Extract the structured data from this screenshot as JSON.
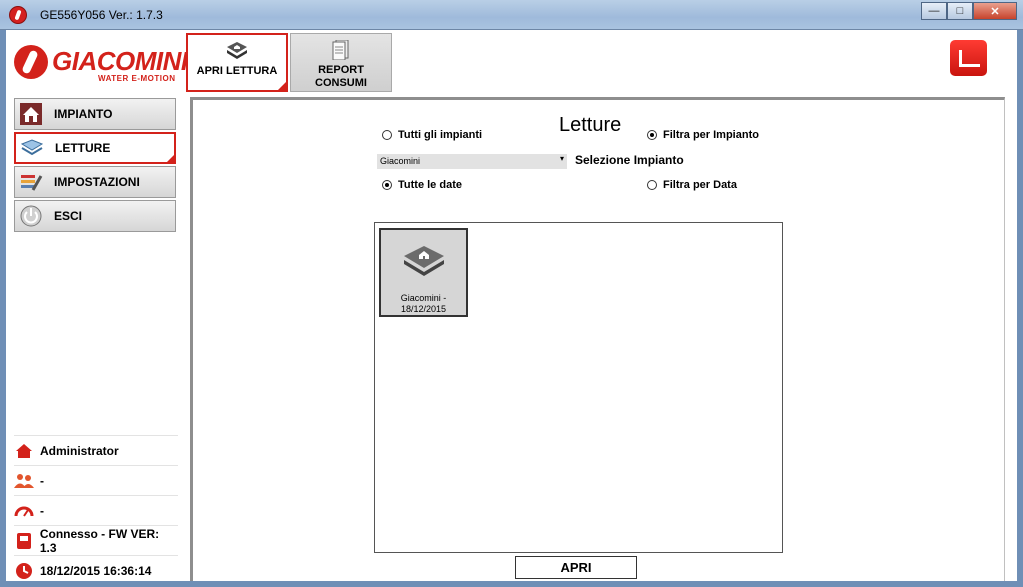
{
  "window": {
    "title": "GE556Y056 Ver.: 1.7.3",
    "minimize_glyph": "—",
    "maximize_glyph": "□",
    "close_glyph": "✕"
  },
  "logo": {
    "name": "GIACOMINI",
    "tagline": "WATER E-MOTION"
  },
  "tabs": [
    {
      "label": "APRI LETTURA",
      "icon": "folder-home-icon",
      "active": true
    },
    {
      "label": "REPORT\nCONSUMI",
      "icon": "document-icon",
      "active": false
    }
  ],
  "sidebar": {
    "items": [
      {
        "label": "IMPIANTO",
        "icon": "house-icon"
      },
      {
        "label": "LETTURE",
        "icon": "readings-icon",
        "active": true
      },
      {
        "label": "IMPOSTAZIONI",
        "icon": "tools-icon"
      },
      {
        "label": "ESCI",
        "icon": "power-icon"
      }
    ],
    "status": [
      {
        "label": "Administrator",
        "icon": "user-home-icon"
      },
      {
        "label": "-",
        "icon": "users-icon"
      },
      {
        "label": "-",
        "icon": "gauge-icon"
      },
      {
        "label": "Connesso - FW VER: 1.3",
        "icon": "device-icon"
      },
      {
        "label": "18/12/2015 16:36:14",
        "icon": "clock-icon"
      }
    ]
  },
  "main": {
    "title": "Letture",
    "radio_all_plants": "Tutti gli impianti",
    "radio_filter_plant": "Filtra per Impianto",
    "plant_select_value": "Giacomini",
    "plant_select_label": "Selezione Impianto",
    "radio_all_dates": "Tutte le date",
    "radio_filter_date": "Filtra per Data",
    "readings": [
      {
        "line1": "Giacomini  -",
        "line2": "18/12/2015"
      }
    ],
    "open_button": "APRI"
  },
  "colors": {
    "accent": "#d3221b"
  }
}
